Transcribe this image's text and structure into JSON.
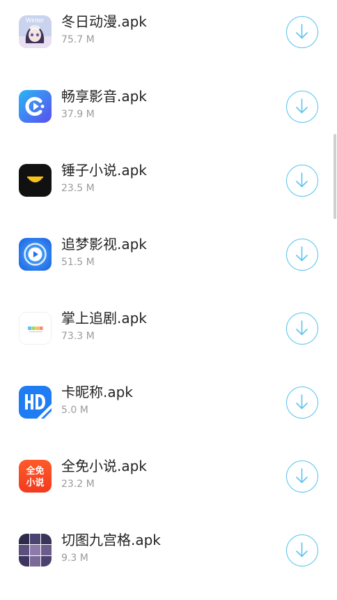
{
  "download_list": {
    "items": [
      {
        "icon": "anime-girl-icon",
        "name": "冬日动漫.apk",
        "size": "75.7 M",
        "icon_text": "Winter"
      },
      {
        "icon": "play-c-icon",
        "name": "畅享影音.apk",
        "size": "37.9 M"
      },
      {
        "icon": "eye-face-icon",
        "name": "锤子小说.apk",
        "size": "23.5 M"
      },
      {
        "icon": "play-circle-icon",
        "name": "追梦影视.apk",
        "size": "51.5 M"
      },
      {
        "icon": "color-blocks-icon",
        "name": "掌上追剧.apk",
        "size": "73.3 M"
      },
      {
        "icon": "hd-icon",
        "name": "卡昵称.apk",
        "size": "5.0 M"
      },
      {
        "icon": "text-logo-icon",
        "name": "全免小说.apk",
        "size": "23.2 M",
        "icon_text_top": "全免",
        "icon_text_bottom": "小说"
      },
      {
        "icon": "grid-icon",
        "name": "切图九宫格.apk",
        "size": "9.3 M"
      }
    ]
  },
  "colors": {
    "accent": "#5bc5ee",
    "title_text": "#222222",
    "secondary_text": "#9a9a9a"
  }
}
